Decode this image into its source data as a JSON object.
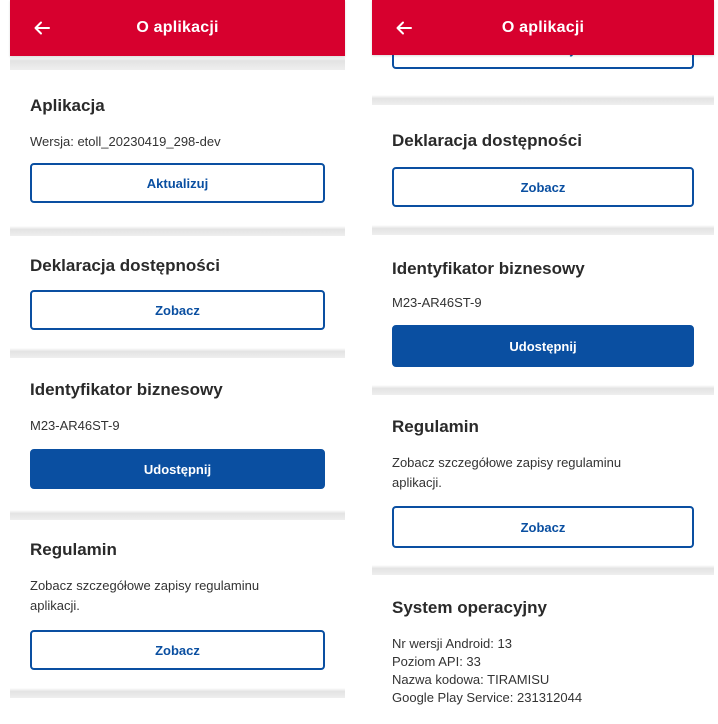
{
  "appbar": {
    "title": "O aplikacji",
    "back_icon": "arrow-left-icon"
  },
  "sections": {
    "app": {
      "heading": "Aplikacja",
      "version_label": "Wersja:",
      "version_value": "etoll_20230419_298-dev",
      "button": "Aktualizuj"
    },
    "accessibility": {
      "heading": "Deklaracja dostępności",
      "button": "Zobacz"
    },
    "business_id": {
      "heading": "Identyfikator biznesowy",
      "value": "M23-AR46ST-9",
      "button": "Udostępnij"
    },
    "terms": {
      "heading": "Regulamin",
      "text": "Zobacz szczegółowe zapisy regulaminu aplikacji.",
      "button": "Zobacz"
    },
    "os": {
      "heading": "System operacyjny",
      "lines": [
        "Nr wersji Android: 13",
        "Poziom API: 33",
        "Nazwa kodowa: TIRAMISU",
        "Google Play Service: 231312044"
      ]
    }
  },
  "colors": {
    "appbar": "#d7002e",
    "primary": "#0a4fa1"
  }
}
